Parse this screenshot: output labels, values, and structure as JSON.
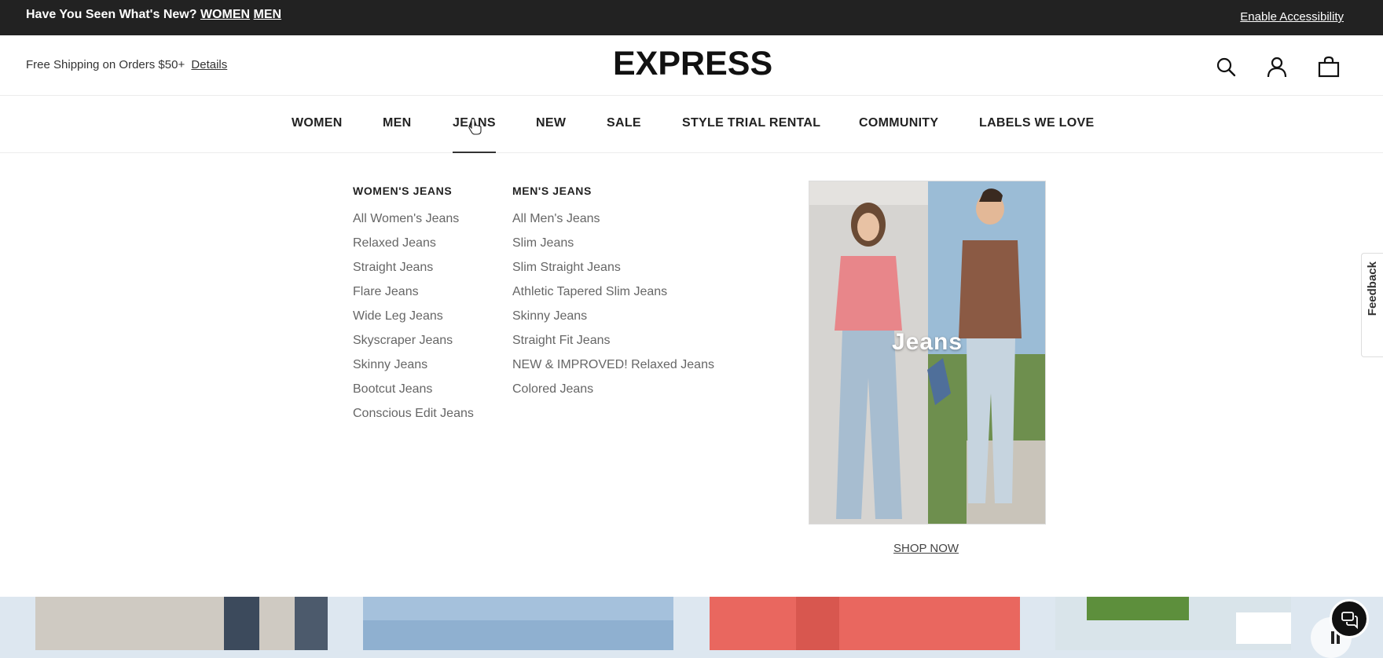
{
  "promo_bar": {
    "text": "Have You Seen What's New?",
    "link_women": "WOMEN",
    "link_men": "MEN",
    "accessibility": "Enable Accessibility"
  },
  "header": {
    "shipping_text": "Free Shipping on Orders $50+",
    "details_link": "Details",
    "logo": "EXPRESS"
  },
  "nav": {
    "items": [
      "WOMEN",
      "MEN",
      "JEANS",
      "NEW",
      "SALE",
      "STYLE TRIAL RENTAL",
      "COMMUNITY",
      "LABELS WE LOVE"
    ],
    "active": "JEANS"
  },
  "dropdown": {
    "womens": {
      "heading": "WOMEN'S JEANS",
      "links": [
        "All Women's Jeans",
        "Relaxed Jeans",
        "Straight Jeans",
        "Flare Jeans",
        "Wide Leg Jeans",
        "Skyscraper Jeans",
        "Skinny Jeans",
        "Bootcut Jeans",
        "Conscious Edit Jeans"
      ]
    },
    "mens": {
      "heading": "MEN'S JEANS",
      "links": [
        "All Men's Jeans",
        "Slim Jeans",
        "Slim Straight Jeans",
        "Athletic Tapered Slim Jeans",
        "Skinny Jeans",
        "Straight Fit Jeans",
        "NEW & IMPROVED! Relaxed Jeans",
        "Colored Jeans"
      ]
    },
    "promo_label": "Jeans",
    "shop_now": "SHOP NOW"
  },
  "feedback": "Feedback",
  "colors": {
    "promo_bg": "#222222",
    "text_dark": "#222222",
    "link_gray": "#666666"
  }
}
